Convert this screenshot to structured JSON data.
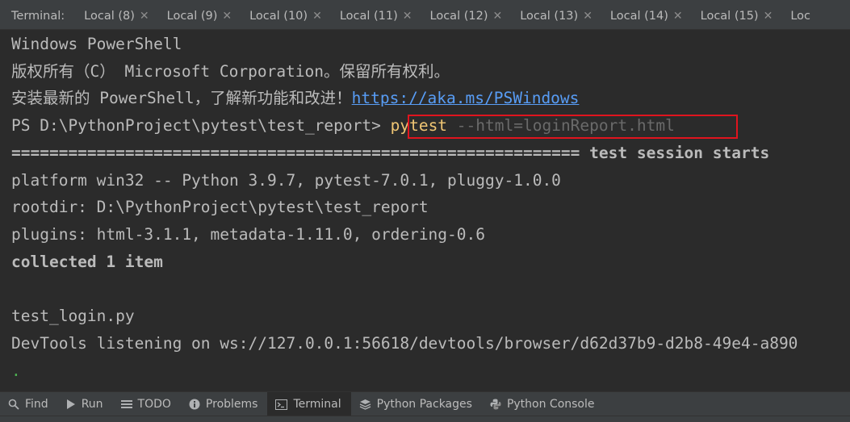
{
  "tabbar": {
    "title": "Terminal:",
    "tabs": [
      {
        "label": "Local (8)"
      },
      {
        "label": "Local (9)"
      },
      {
        "label": "Local (10)"
      },
      {
        "label": "Local (11)"
      },
      {
        "label": "Local (12)"
      },
      {
        "label": "Local (13)"
      },
      {
        "label": "Local (14)"
      },
      {
        "label": "Local (15)"
      },
      {
        "label": "Loc"
      }
    ]
  },
  "terminal": {
    "line1": "Windows PowerShell",
    "line2": "版权所有（C） Microsoft Corporation。保留所有权利。",
    "line3_prefix": "安装最新的 PowerShell，了解新功能和改进！",
    "line3_link": "https://aka.ms/PSWindows",
    "prompt": "PS D:\\PythonProject\\pytest\\test_report> ",
    "command": "pytest",
    "command_args": " --html=loginReport.html",
    "session_line_rule": "============================================================ ",
    "session_line_text": "test session starts",
    "platform": "platform win32 -- Python 3.9.7, pytest-7.0.1, pluggy-1.0.0",
    "rootdir": "rootdir: D:\\PythonProject\\pytest\\test_report",
    "plugins": "plugins: html-3.1.1, metadata-1.11.0, ordering-0.6",
    "collected": "collected 1 item",
    "test_file": "test_login.py",
    "devtools": "DevTools listening on ws://127.0.0.1:56618/devtools/browser/d62d37b9-d2b8-49e4-a890",
    "progress": "."
  },
  "toolwindows": {
    "items": [
      {
        "label": "Find",
        "icon": "search-icon"
      },
      {
        "label": "Run",
        "icon": "play-icon"
      },
      {
        "label": "TODO",
        "icon": "list-icon"
      },
      {
        "label": "Problems",
        "icon": "info-icon"
      },
      {
        "label": "Terminal",
        "icon": "terminal-icon",
        "active": true
      },
      {
        "label": "Python Packages",
        "icon": "layers-icon"
      },
      {
        "label": "Python Console",
        "icon": "python-icon"
      }
    ]
  },
  "colors": {
    "background": "#2b2b2b",
    "panel": "#3c3f41",
    "text": "#bbbbbb",
    "link": "#589df6",
    "command": "#f0c674",
    "highlight": "#e0141e"
  }
}
